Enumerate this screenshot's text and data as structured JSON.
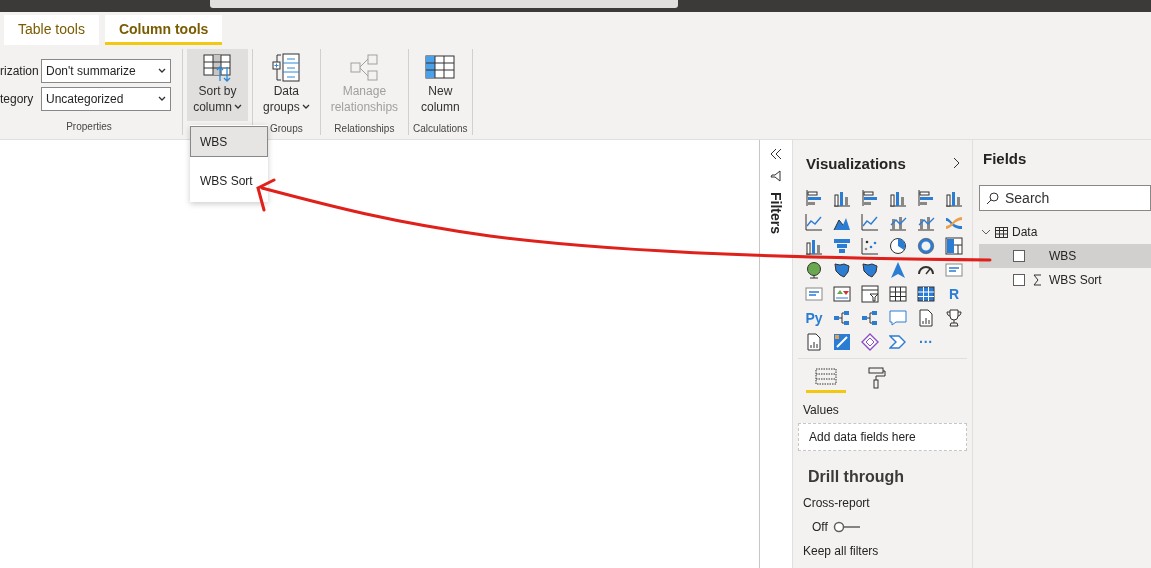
{
  "tabs": [
    {
      "label": "Table tools",
      "selected": false
    },
    {
      "label": "Column tools",
      "selected": true
    }
  ],
  "ribbon": {
    "properties": {
      "label": "Properties",
      "fields": [
        {
          "label": "rization",
          "value": "Don't summarize"
        },
        {
          "label": "tegory",
          "value": "Uncategorized"
        }
      ]
    },
    "groups": [
      {
        "buttons": [
          {
            "kind": "sort",
            "lines": [
              "Sort by",
              "column"
            ],
            "caret": true,
            "pressed": true,
            "disabled": false
          }
        ]
      },
      {
        "label": "Groups",
        "buttons": [
          {
            "kind": "groups",
            "lines": [
              "Data",
              "groups"
            ],
            "caret": true,
            "pressed": false,
            "disabled": false
          }
        ]
      },
      {
        "label": "Relationships",
        "buttons": [
          {
            "kind": "relationships",
            "lines": [
              "Manage",
              "relationships"
            ],
            "caret": false,
            "pressed": false,
            "disabled": true
          }
        ]
      },
      {
        "label": "Calculations",
        "buttons": [
          {
            "kind": "new-column",
            "lines": [
              "New",
              "column"
            ],
            "caret": false,
            "pressed": false,
            "disabled": false
          }
        ]
      }
    ]
  },
  "menu": {
    "items": [
      {
        "label": "WBS",
        "selected": true
      },
      {
        "label": "WBS Sort",
        "selected": false
      }
    ]
  },
  "filters": {
    "label": "Filters"
  },
  "visualizations": {
    "title": "Visualizations",
    "visuals": [
      {
        "kind": "hbar"
      },
      {
        "kind": "vbar"
      },
      {
        "kind": "hbar"
      },
      {
        "kind": "vbar"
      },
      {
        "kind": "hbar"
      },
      {
        "kind": "vbar"
      },
      {
        "kind": "line"
      },
      {
        "kind": "area"
      },
      {
        "kind": "line"
      },
      {
        "kind": "combo"
      },
      {
        "kind": "combo"
      },
      {
        "kind": "ribbon"
      },
      {
        "kind": "vbar"
      },
      {
        "kind": "funnel"
      },
      {
        "kind": "scatter"
      },
      {
        "kind": "pie"
      },
      {
        "kind": "donut"
      },
      {
        "kind": "treemap"
      },
      {
        "kind": "globe"
      },
      {
        "kind": "map"
      },
      {
        "kind": "map"
      },
      {
        "kind": "arrow"
      },
      {
        "kind": "gauge"
      },
      {
        "kind": "card"
      },
      {
        "kind": "card"
      },
      {
        "kind": "kpi"
      },
      {
        "kind": "slicer"
      },
      {
        "kind": "table"
      },
      {
        "kind": "matrix"
      },
      {
        "kind": "text",
        "label": "R"
      },
      {
        "kind": "text",
        "label": "Py"
      },
      {
        "kind": "tree"
      },
      {
        "kind": "tree"
      },
      {
        "kind": "speech"
      },
      {
        "kind": "document"
      },
      {
        "kind": "trophy"
      },
      {
        "kind": "document"
      },
      {
        "kind": "apps"
      },
      {
        "kind": "diamond"
      },
      {
        "kind": "automate"
      },
      {
        "kind": "text",
        "label": "···"
      }
    ],
    "tabs": [
      {
        "kind": "fields",
        "selected": true
      },
      {
        "kind": "format",
        "selected": false
      }
    ],
    "wells": [
      {
        "label": "Values",
        "placeholder": "Add data fields here"
      }
    ],
    "drill_through": {
      "title": "Drill through",
      "cross_report": {
        "label": "Cross-report",
        "state_label": "Off",
        "on": false
      },
      "keep_all_filters": "Keep all filters"
    }
  },
  "fields": {
    "title": "Fields",
    "search": {
      "placeholder": "Search"
    },
    "tree": [
      {
        "label": "Data",
        "expanded": true,
        "children": [
          {
            "label": "WBS",
            "kind": "text",
            "selected": true,
            "checked": false
          },
          {
            "label": "WBS Sort",
            "kind": "measure",
            "selected": false,
            "checked": false
          }
        ]
      }
    ]
  }
}
